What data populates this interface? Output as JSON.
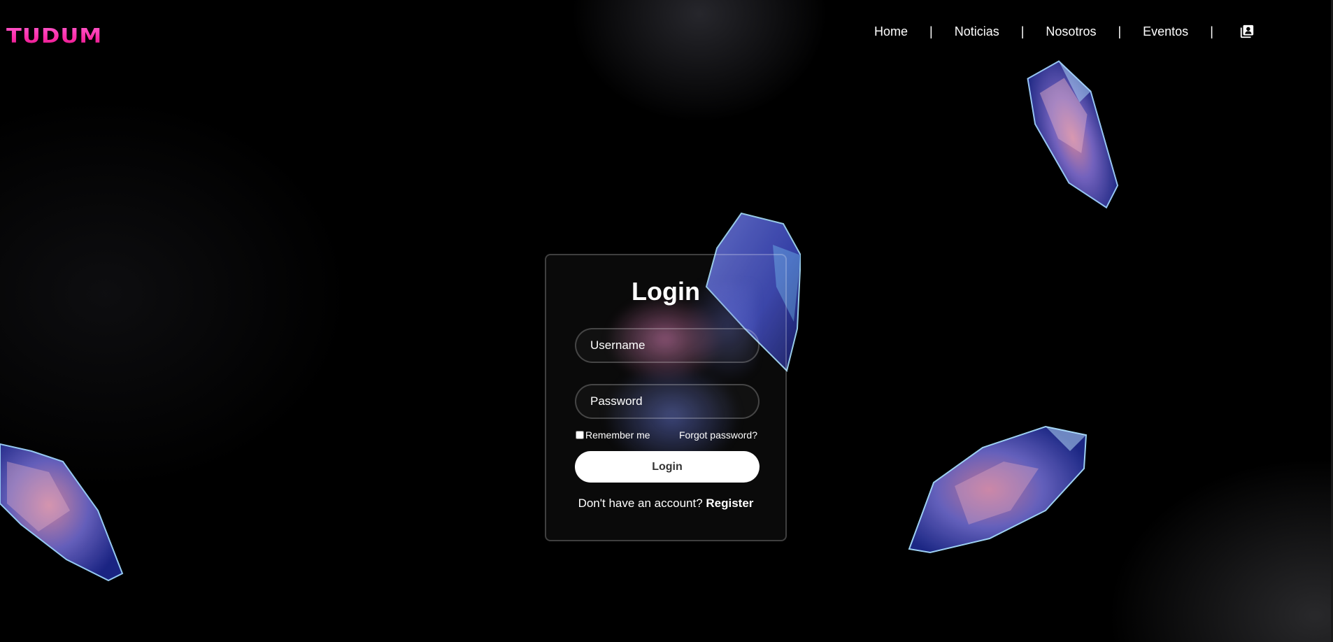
{
  "brand": {
    "logo_text": "TUDUM",
    "logo_color": "#ff2aa6"
  },
  "nav": {
    "items": [
      {
        "label": "Home"
      },
      {
        "label": "Noticias"
      },
      {
        "label": "Nosotros"
      },
      {
        "label": "Eventos"
      }
    ],
    "separator": "|",
    "account_icon": "account-box-icon"
  },
  "login": {
    "title": "Login",
    "username_placeholder": "Username",
    "password_placeholder": "Password",
    "remember_label": "Remember me",
    "remember_checked": false,
    "forgot_label": "Forgot password?",
    "submit_label": "Login",
    "register_prompt": "Don't have an account?",
    "register_label": "Register"
  },
  "theme": {
    "background": "#000000",
    "button_bg": "#ffffff",
    "text": "#ffffff"
  }
}
